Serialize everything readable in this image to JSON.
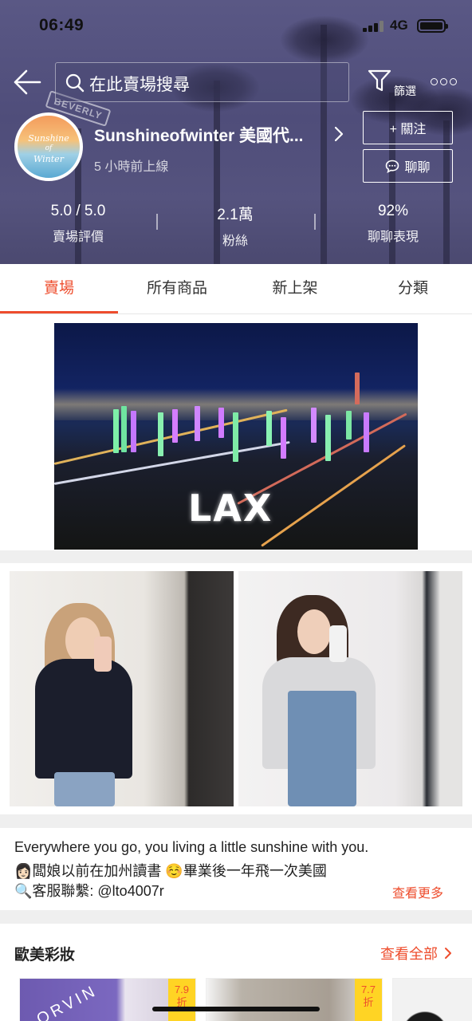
{
  "status_bar": {
    "time": "06:49",
    "network": "4G"
  },
  "header": {
    "search_placeholder": "在此賣場搜尋",
    "filter_label": "篩選",
    "street_sign": "BEVERLY"
  },
  "shop": {
    "avatar_text": [
      "Sunshine",
      "of",
      "Winter"
    ],
    "name": "Sunshineofwinter 美國代...",
    "last_online": "5 小時前上線",
    "follow_label": "+ 關注",
    "chat_label": "聊聊"
  },
  "stats": [
    {
      "value": "5.0 / 5.0",
      "label": "賣場評價"
    },
    {
      "value": "2.1萬",
      "label": "粉絲"
    },
    {
      "value": "92%",
      "label": "聊聊表現"
    }
  ],
  "tabs": [
    "賣場",
    "所有商品",
    "新上架",
    "分類"
  ],
  "banner": {
    "text": "LAX"
  },
  "description": {
    "lines": [
      "Everywhere you go, you living a little sunshine with you.",
      "👩🏻闆娘以前在加州讀書 ☺️畢業後一年飛一次美國",
      "🔍客服聯繫: @lto4007r"
    ],
    "see_more": "查看更多"
  },
  "category": {
    "title": "歐美彩妝",
    "see_all": "查看全部",
    "products": [
      {
        "discount": "7.9",
        "unit": "折",
        "brand_text": "ORVIN"
      },
      {
        "discount": "7.7",
        "unit": "折"
      }
    ]
  },
  "colors": {
    "accent": "#ee4d2d",
    "header_bg": "#55537e",
    "discount_bg": "#ffd424"
  }
}
